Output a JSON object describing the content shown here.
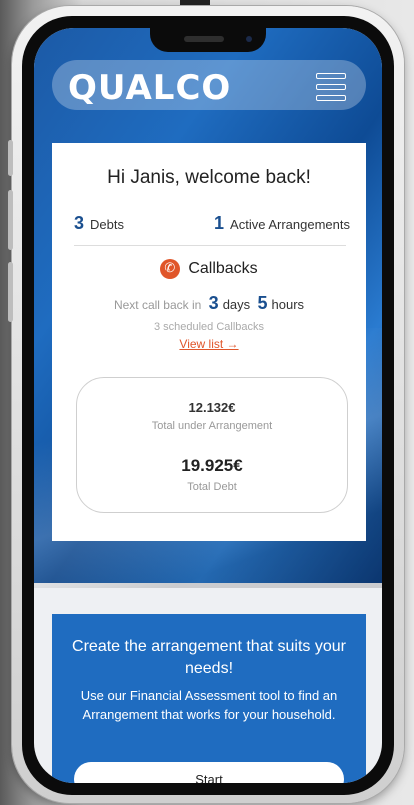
{
  "app": {
    "logo": "QUALCO"
  },
  "welcome": {
    "greeting": "Hi Janis, welcome back!"
  },
  "stats": {
    "debts_count": "3",
    "debts_label": "Debts",
    "arrangements_count": "1",
    "arrangements_label": "Active Arrangements"
  },
  "callbacks": {
    "title": "Callbacks",
    "next_prefix": "Next call back in",
    "days_value": "3",
    "days_unit": "days",
    "hours_value": "5",
    "hours_unit": "hours",
    "scheduled": "3 scheduled Callbacks",
    "view_link": "View list →"
  },
  "totals": {
    "arrangement_amount": "12.132€",
    "arrangement_label": "Total under Arrangement",
    "debt_amount": "19.925€",
    "debt_label": "Total Debt"
  },
  "promo": {
    "title": "Create the arrangement that suits your needs!",
    "body": "Use our Financial Assessment tool to find an Arrangement that works for your household.",
    "button": "Start"
  },
  "icons": {
    "menu": "hamburger-menu-icon",
    "callback": "phone-icon"
  },
  "colors": {
    "brand_blue": "#1f6cc0",
    "accent": "#e0562a",
    "number_blue": "#1a4f8f"
  }
}
